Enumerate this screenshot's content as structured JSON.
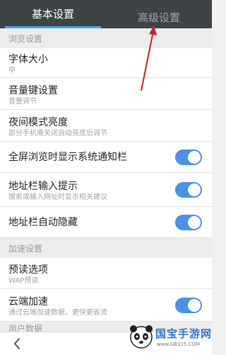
{
  "tabs": [
    {
      "label": "基本设置",
      "active": true
    },
    {
      "label": "高级设置",
      "active": false
    }
  ],
  "sections": {
    "browse": "浏览设置",
    "speed": "加速设置",
    "user_data": "用户数据"
  },
  "items": {
    "font_size": {
      "title": "字体大小",
      "sub": "中"
    },
    "volume_key": {
      "title": "音量键设置",
      "sub": "音量调节"
    },
    "night_mode": {
      "title": "夜间模式亮度",
      "sub": "部分手机需关闭自动亮度后调节"
    },
    "fullscreen_notify": {
      "title": "全屏浏览时显示系统通知栏",
      "enabled": true
    },
    "address_hint": {
      "title": "地址栏输入提示",
      "sub": "搜索或输入网址时显示相关建议",
      "enabled": true
    },
    "address_autohide": {
      "title": "地址栏自动隐藏",
      "enabled": true
    },
    "preload": {
      "title": "预读选项",
      "sub": "WAP预读"
    },
    "cloud_accel": {
      "title": "云端加速",
      "sub": "通过云端加速数据，更快更省流",
      "enabled": true
    }
  },
  "colors": {
    "tab_bar": "#3e4347",
    "accent": "#4aa3f3",
    "toggle_on": "#4a90e8",
    "annotation_arrow": "#c8202a"
  },
  "watermark": {
    "text": "国宝手游网",
    "url": "www.GB315.COM"
  },
  "icons": {
    "back": "chevron-left-icon"
  }
}
